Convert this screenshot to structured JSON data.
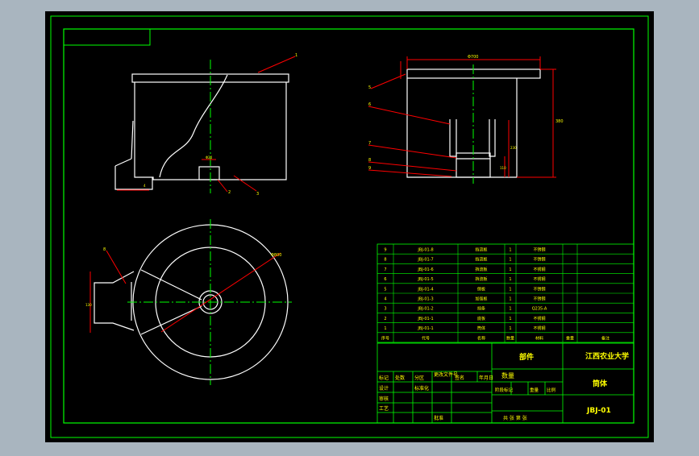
{
  "title_block": {
    "school": "江西农业大学",
    "category": "部件",
    "part_name": "筒体",
    "drawing_no": "JBJ-01",
    "quantity_label": "数量",
    "row_labels": [
      "标记",
      "处数",
      "分区",
      "更改文件号",
      "签名",
      "年月日",
      "设计",
      "标准化",
      "审核",
      "工艺",
      "批准"
    ],
    "stage_labels": [
      "阶段标记",
      "重量",
      "比例"
    ],
    "sheet_text": "共 张 第 张"
  },
  "bom": {
    "header": [
      "序号",
      "代号",
      "名称",
      "数量",
      "材料",
      "重量",
      "备注"
    ],
    "rows": [
      {
        "no": "9",
        "code": "JBJ-01-8",
        "name": "挡流板",
        "qty": "1",
        "material": "不锈钢"
      },
      {
        "no": "8",
        "code": "JBJ-01-7",
        "name": "挡流板",
        "qty": "1",
        "material": "不锈钢"
      },
      {
        "no": "7",
        "code": "JBJ-01-6",
        "name": "挡流板",
        "qty": "1",
        "material": "不锈钢"
      },
      {
        "no": "6",
        "code": "JBJ-01-5",
        "name": "挡流板",
        "qty": "1",
        "material": "不锈钢"
      },
      {
        "no": "5",
        "code": "JBJ-01-4",
        "name": "侧板",
        "qty": "1",
        "material": "不锈钢"
      },
      {
        "no": "4",
        "code": "JBJ-01-3",
        "name": "加强板",
        "qty": "1",
        "material": "不锈钢"
      },
      {
        "no": "3",
        "code": "JBJ-01-2",
        "name": "挡条",
        "qty": "1",
        "material": "Q235-A"
      },
      {
        "no": "2",
        "code": "JBJ-01-1",
        "name": "底板",
        "qty": "1",
        "material": "不锈钢"
      },
      {
        "no": "1",
        "code": "JBJ-01-1",
        "name": "筒体",
        "qty": "1",
        "material": "不锈钢"
      }
    ]
  },
  "dimensions": {
    "top_width": "Φ700",
    "height": "380",
    "slot_height": "110",
    "slot_height2": "230",
    "slot_width": "Φ20",
    "plan_diameter": "Φ800",
    "side_dim": "130",
    "leader_1": "1",
    "leader_2": "2",
    "leader_3": "3",
    "leader_4": "4",
    "leader_5": "5",
    "leader_6": "6",
    "leader_7": "7",
    "leader_8": "8",
    "leader_9": "9"
  },
  "colors": {
    "background": "#000000",
    "frame": "#00ff00",
    "outline": "#ffffff",
    "centerline": "#00ff00",
    "dimension": "#ff0000",
    "text": "#ffff00",
    "window_bg": "#a9b5bf"
  }
}
